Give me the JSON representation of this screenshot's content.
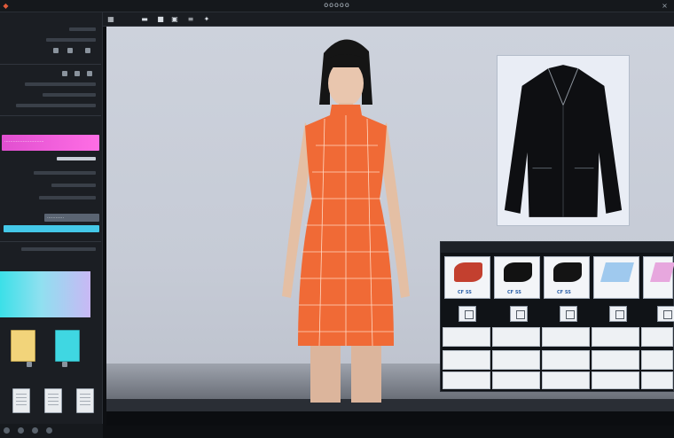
{
  "app": {
    "title": "ooooo"
  },
  "toolbar": {
    "icons": [
      "grid-icon",
      "folder-icon",
      "save-icon",
      "copy-icon",
      "list-icon",
      "star-icon"
    ]
  },
  "sidebar": {
    "pink_label": "............................",
    "button_label": "............",
    "swatches": [
      "#f2d47a",
      "#3fd7e2"
    ],
    "gradient_colors": [
      "#3be0e8",
      "#8fe0f0",
      "#c9b8f4"
    ]
  },
  "viewport": {
    "background": "#c9ced9",
    "dress_color": "#f06a36"
  },
  "library": {
    "thumbs": [
      {
        "label": "CF SS",
        "color": "#c3402f"
      },
      {
        "label": "CF SS",
        "color": "#121212"
      },
      {
        "label": "CF SS",
        "color": "#141414"
      },
      {
        "label": "",
        "color": "#9fc9ee"
      },
      {
        "label": "",
        "color": "#e7a7de"
      }
    ]
  }
}
